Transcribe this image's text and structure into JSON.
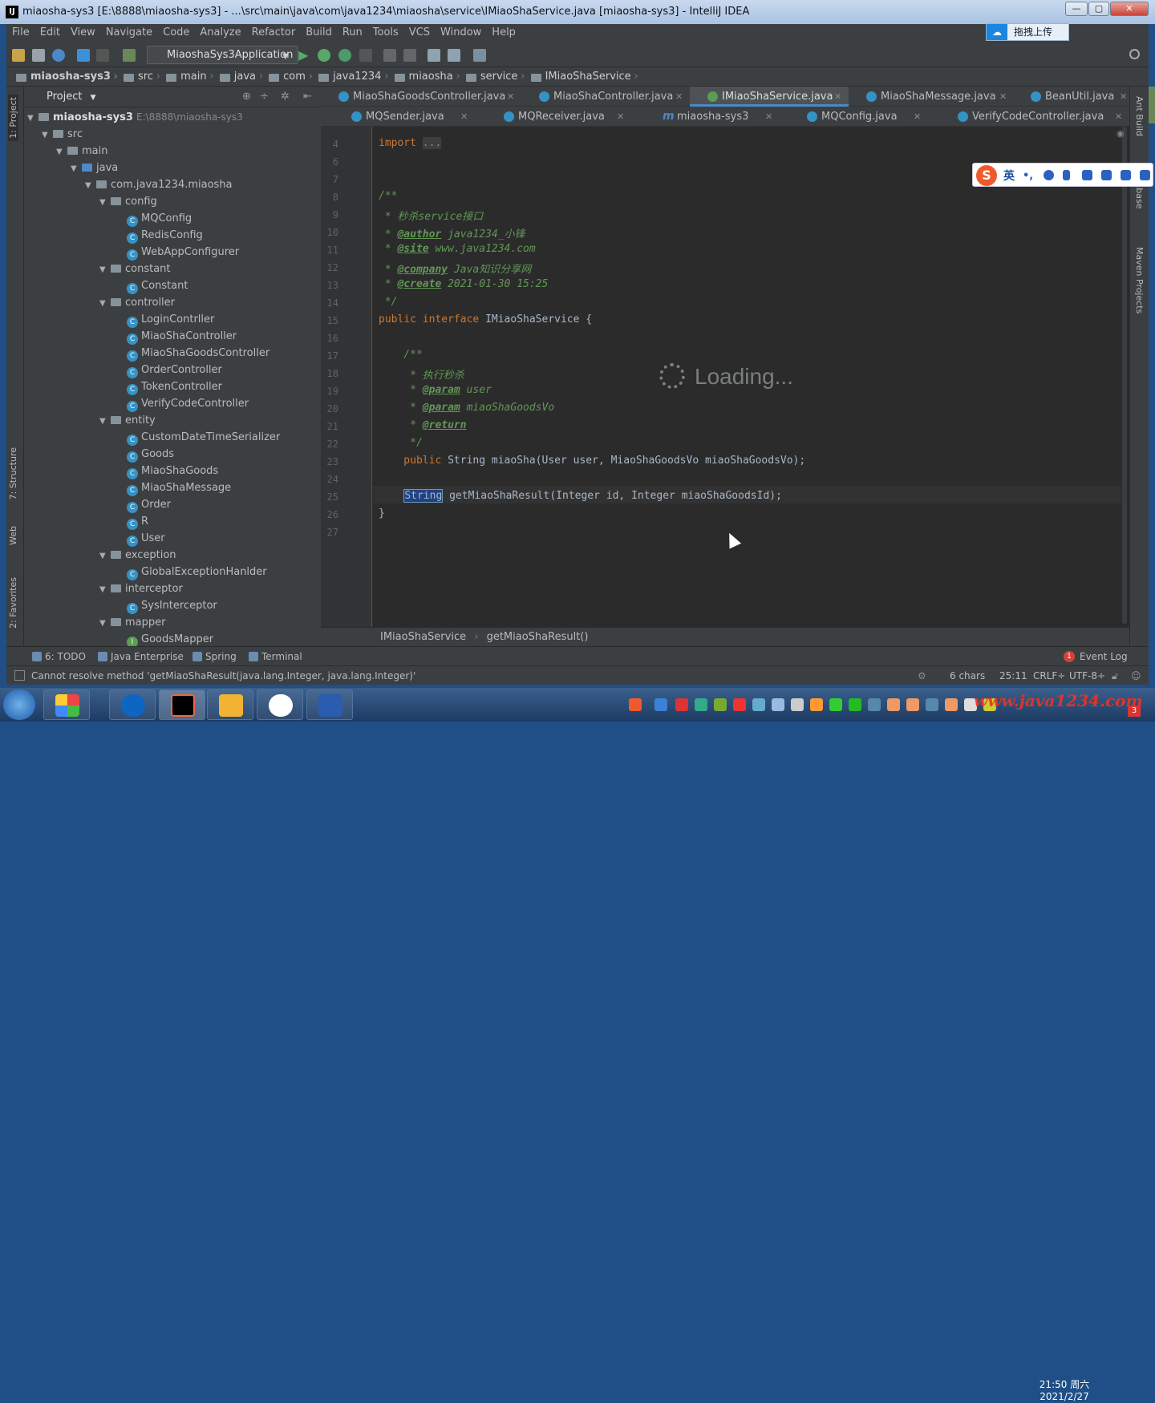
{
  "window": {
    "title": "miaosha-sys3 [E:\\8888\\miaosha-sys3] - ...\\src\\main\\java\\com\\java1234\\miaosha\\service\\IMiaoShaService.java [miaosha-sys3] - IntelliJ IDEA",
    "logo": "IJ"
  },
  "menu": [
    "File",
    "Edit",
    "View",
    "Navigate",
    "Code",
    "Analyze",
    "Refactor",
    "Build",
    "Run",
    "Tools",
    "VCS",
    "Window",
    "Help"
  ],
  "upload_label": "拖拽上传",
  "run_config": "MiaoshaSys3Application",
  "breadcrumbs": [
    "miaosha-sys3",
    "src",
    "main",
    "java",
    "com",
    "java1234",
    "miaosha",
    "service",
    "IMiaoShaService"
  ],
  "project": {
    "header": "Project",
    "root": "miaosha-sys3",
    "root_path": "E:\\8888\\miaosha-sys3",
    "nodes": [
      "src",
      "main",
      "java",
      "com.java1234.miaosha",
      "config",
      "MQConfig",
      "RedisConfig",
      "WebAppConfigurer",
      "constant",
      "Constant",
      "controller",
      "LoginContrller",
      "MiaoShaController",
      "MiaoShaGoodsController",
      "OrderController",
      "TokenController",
      "VerifyCodeController",
      "entity",
      "CustomDateTimeSerializer",
      "Goods",
      "MiaoShaGoods",
      "MiaoShaMessage",
      "Order",
      "R",
      "User",
      "exception",
      "GlobalExceptionHanlder",
      "interceptor",
      "SysInterceptor",
      "mapper",
      "GoodsMapper"
    ]
  },
  "left_tabs": [
    "1: Project",
    "7: Structure",
    "Web",
    "2: Favorites"
  ],
  "right_tabs": [
    "Ant Build",
    "Database",
    "Maven Projects"
  ],
  "tabs_row1": [
    "MiaoShaGoodsController.java",
    "MiaoShaController.java",
    "IMiaoShaService.java",
    "MiaoShaMessage.java",
    "BeanUtil.java"
  ],
  "tabs_row2": [
    "MQSender.java",
    "MQReceiver.java",
    "miaosha-sys3",
    "MQConfig.java",
    "VerifyCodeController.java"
  ],
  "line_numbers": [
    "4",
    "6",
    "7",
    "8",
    "9",
    "10",
    "11",
    "12",
    "13",
    "14",
    "15",
    "16",
    "17",
    "18",
    "19",
    "20",
    "21",
    "22",
    "23",
    "24",
    "25",
    "26",
    "27"
  ],
  "code": {
    "l4a": "import ",
    "l4b": "...",
    "l8": "/**",
    "l9": " * 秒杀service接口",
    "l10a": " * ",
    "l10b": "@author",
    "l10c": " java1234_小锋",
    "l11a": " * ",
    "l11b": "@site",
    "l11c": " www.java1234.com",
    "l12a": " * ",
    "l12b": "@company",
    "l12c": " Java知识分享网",
    "l13a": " * ",
    "l13b": "@create",
    "l13c": " 2021-01-30 15:25",
    "l14": " */",
    "l15a": "public interface ",
    "l15b": "IMiaoShaService {",
    "l17": "    /**",
    "l18": "     * 执行秒杀",
    "l19a": "     * ",
    "l19b": "@param",
    "l19c": " user",
    "l20a": "     * ",
    "l20b": "@param",
    "l20c": " miaoShaGoodsVo",
    "l21a": "     * ",
    "l21b": "@return",
    "l22": "     */",
    "l23a": "    public ",
    "l23b": "String miaoSha(User user, MiaoShaGoodsVo miaoShaGoodsVo);",
    "l25a": "    ",
    "l25b": "String",
    "l25c": " getMiaoShaResult(Integer id, Integer miaoShaGoodsId);",
    "l26": "}"
  },
  "loading_text": "Loading...",
  "editor_breadcrumb": [
    "IMiaoShaService",
    "getMiaoShaResult()"
  ],
  "ime": {
    "label": "英"
  },
  "bottom_tools": [
    "6: TODO",
    "Java Enterprise",
    "Spring",
    "Terminal",
    "Event Log"
  ],
  "event_count": "1",
  "status": {
    "message": "Cannot resolve method 'getMiaoShaResult(java.lang.Integer, java.lang.Integer)'",
    "chars": "6 chars",
    "position": "25:11",
    "line_sep": "CRLF÷",
    "encoding": "UTF-8÷"
  },
  "clock": {
    "time": "21:50 周六",
    "date": "2021/2/27"
  },
  "watermark": "www.java1234.com",
  "notification_count": "3"
}
